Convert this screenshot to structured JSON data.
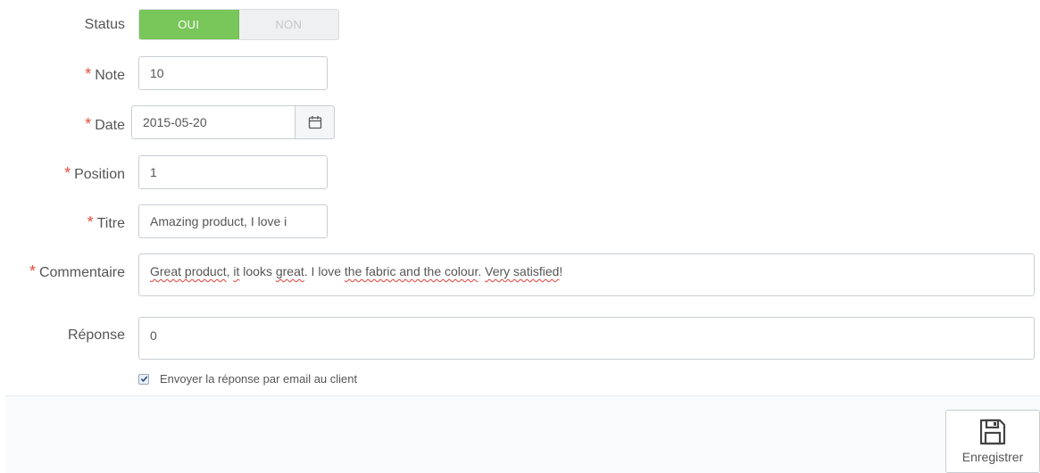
{
  "status": {
    "label": "Status",
    "yes": "OUI",
    "no": "NON",
    "selected": "OUI"
  },
  "required_mark": "*",
  "note": {
    "label": "Note",
    "value": "10"
  },
  "date": {
    "label": "Date",
    "value": "2015-05-20",
    "icon": "calendar-icon"
  },
  "position": {
    "label": "Position",
    "value": "1"
  },
  "titre": {
    "label": "Titre",
    "value": "Amazing product, I love i"
  },
  "commentaire": {
    "label": "Commentaire",
    "value_parts": [
      "Great product",
      ", ",
      "it",
      " looks ",
      "great",
      ". I love ",
      "the fabric and the colour",
      ". ",
      "Very satisfied",
      "!"
    ]
  },
  "reponse": {
    "label": "Réponse",
    "value": "0"
  },
  "send_email": {
    "label": "Envoyer la réponse par email au client",
    "checked": true
  },
  "save": {
    "label": "Enregistrer",
    "icon": "floppy-disk-icon"
  },
  "colors": {
    "accent_green": "#79c65a",
    "required_red": "#e84a3d"
  }
}
